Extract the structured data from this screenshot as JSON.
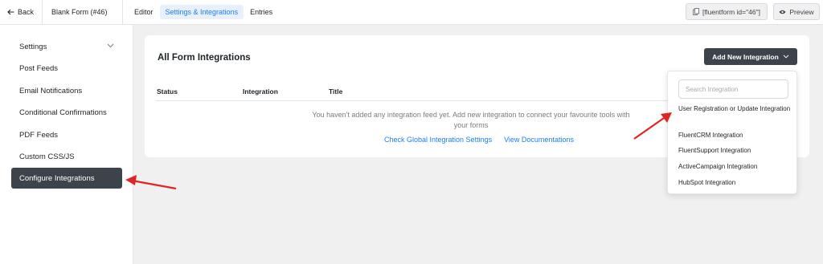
{
  "topbar": {
    "back_label": "Back",
    "form_name": "Blank Form (#46)",
    "menu": [
      {
        "label": "Editor",
        "active": false
      },
      {
        "label": "Settings & Integrations",
        "active": true
      },
      {
        "label": "Entries",
        "active": false
      }
    ],
    "shortcode": "[fluentform id=\"46\"]",
    "preview_label": "Preview"
  },
  "sidebar": {
    "items": [
      {
        "label": "Settings"
      },
      {
        "label": "Post Feeds"
      },
      {
        "label": "Email Notifications"
      },
      {
        "label": "Conditional Confirmations"
      },
      {
        "label": "PDF Feeds"
      },
      {
        "label": "Custom CSS/JS"
      },
      {
        "label": "Configure Integrations"
      }
    ],
    "active_index": 6
  },
  "main": {
    "title": "All Form Integrations",
    "add_button_label": "Add New Integration",
    "columns": [
      "Status",
      "Integration",
      "Title"
    ],
    "empty_message": "You haven't added any integration feed yet. Add new integration to connect your favourite tools with your forms",
    "links": [
      "Check Global Integration Settings",
      "View Documentations"
    ]
  },
  "dropdown": {
    "search_placeholder": "Search Integration",
    "items": [
      "User Registration or Update Integration",
      "FluentCRM Integration",
      "FluentSupport Integration",
      "ActiveCampaign Integration",
      "HubSpot Integration"
    ]
  },
  "colors": {
    "accent": "#1a7efb",
    "dark_button": "#3c434a",
    "annotation_arrow": "#e02424"
  },
  "icons": {
    "back": "arrow-left-icon",
    "shortcode": "copy-icon",
    "preview": "eye-icon",
    "chevron": "chevron-down-icon"
  }
}
